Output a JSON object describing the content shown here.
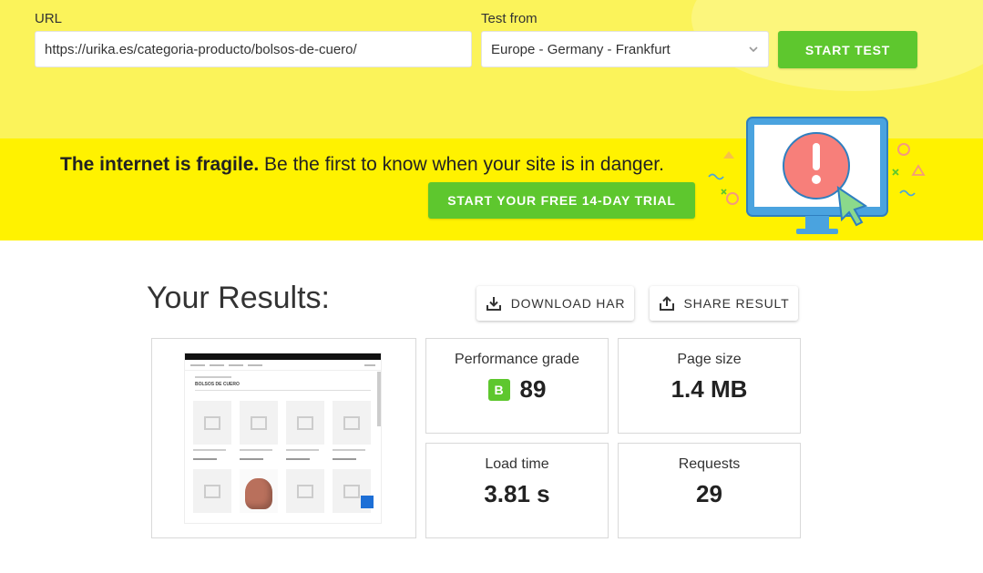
{
  "test_form": {
    "url_label": "URL",
    "url_value": "https://urika.es/categoria-producto/bolsos-de-cuero/",
    "test_from_label": "Test from",
    "test_from_value": "Europe - Germany - Frankfurt",
    "start_test_label": "START TEST"
  },
  "banner": {
    "headline_bold": "The internet is fragile.",
    "headline_rest": " Be the first to know when your site is in danger.",
    "cta_label": "START YOUR FREE 14-DAY TRIAL"
  },
  "results": {
    "title": "Your Results:",
    "download_har_label": "DOWNLOAD HAR",
    "share_result_label": "SHARE RESULT",
    "performance_grade_label": "Performance grade",
    "performance_grade_letter": "B",
    "performance_grade_value": "89",
    "page_size_label": "Page size",
    "page_size_value": "1.4 MB",
    "load_time_label": "Load time",
    "load_time_value": "3.81 s",
    "requests_label": "Requests",
    "requests_value": "29",
    "screenshot_heading": "BOLSOS DE CUERO"
  },
  "colors": {
    "form_bg": "#fbf35a",
    "banner_bg": "#fff200",
    "accent_green": "#5ec72e",
    "alert_red": "#f77f7a",
    "monitor_blue": "#4aa3df"
  },
  "icons": {
    "select": "chevron-down-icon",
    "download": "download-icon",
    "share": "share-icon",
    "alert": "exclamation-icon",
    "cursor": "cursor-icon"
  }
}
